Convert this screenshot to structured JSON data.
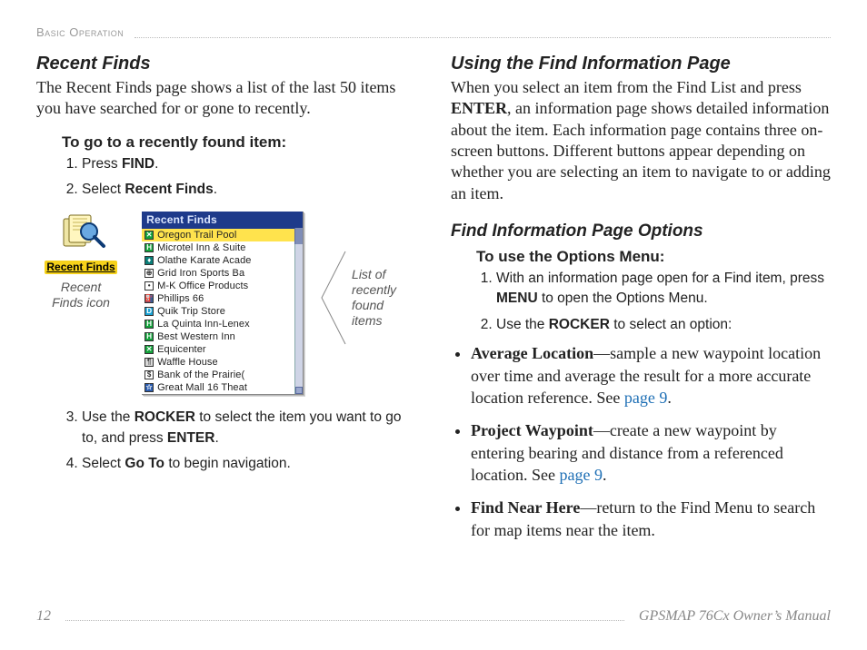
{
  "header": {
    "section": "Basic Operation"
  },
  "left": {
    "h2": "Recent Finds",
    "intro": "The Recent Finds page shows a list of the last 50 items you have searched for or gone to recently.",
    "task_title": "To go to a recently found item:",
    "steps_a": [
      {
        "pre": "Press ",
        "b": "FIND",
        "post": "."
      },
      {
        "pre": "Select ",
        "b": "Recent Finds",
        "post": "."
      }
    ],
    "icon_caption_1": "Recent",
    "icon_caption_2": "Finds icon",
    "icon_label": "Recent Finds",
    "window_title": "Recent Finds",
    "list_items": [
      {
        "glyph": "g",
        "mark": "✕",
        "text": "Oregon Trail Pool",
        "sel": true
      },
      {
        "glyph": "g",
        "mark": "H",
        "text": "Microtel Inn & Suite"
      },
      {
        "glyph": "t",
        "mark": "♦",
        "text": "Olathe Karate Acade"
      },
      {
        "glyph": "w",
        "mark": "⊕",
        "text": "Grid Iron Sports Ba"
      },
      {
        "glyph": "dot",
        "mark": "",
        "text": "M-K Office Products"
      },
      {
        "glyph": "b",
        "mark": "⛽",
        "text": "Phillips 66"
      },
      {
        "glyph": "c",
        "mark": "D",
        "text": "Quik Trip Store"
      },
      {
        "glyph": "g",
        "mark": "H",
        "text": "La Quinta Inn-Lenex"
      },
      {
        "glyph": "g",
        "mark": "H",
        "text": "Best Western Inn"
      },
      {
        "glyph": "g",
        "mark": "✕",
        "text": "Equicenter"
      },
      {
        "glyph": "r",
        "mark": "¶",
        "text": "Waffle House"
      },
      {
        "glyph": "w",
        "mark": "$",
        "text": "Bank of the Prairie("
      },
      {
        "glyph": "b",
        "mark": "☆",
        "text": "Great Mall 16 Theat"
      }
    ],
    "callout_1": "List of",
    "callout_2": "recently",
    "callout_3": "found items",
    "steps_b": [
      {
        "pre": "Use the ",
        "b": "ROCKER",
        "post": " to select the item you want to go to, and press ",
        "b2": "ENTER",
        "post2": "."
      },
      {
        "pre": "Select ",
        "b": "Go To",
        "post": " to begin navigation."
      }
    ]
  },
  "right": {
    "h2": "Using the Find Information Page",
    "p1a": "When you select an item from the Find List and press ",
    "p1b": "ENTER",
    "p1c": ", an information page shows detailed information about the item. Each information page contains three on-screen buttons. Different buttons appear depending on whether you are selecting an item to navigate to or adding an item.",
    "h3": "Find Information Page Options",
    "task_title": "To use the Options Menu:",
    "steps": [
      {
        "pre": "With an information page open for a Find item, press ",
        "b": "MENU",
        "post": " to open the Options Menu."
      },
      {
        "pre": "Use the ",
        "b": "ROCKER",
        "post": " to select an option:"
      }
    ],
    "bullets": [
      {
        "lead": "Average Location",
        "body": "—sample a new waypoint location over time and average the result for a more accurate location reference. See ",
        "link": "page 9",
        "post": "."
      },
      {
        "lead": "Project Waypoint",
        "body": "—create a new waypoint by entering bearing and distance from a referenced location. See ",
        "link": "page 9",
        "post": "."
      },
      {
        "lead": "Find Near Here",
        "body": "—return to the Find Menu to search for map items near the item."
      }
    ]
  },
  "footer": {
    "page": "12",
    "manual": "GPSMAP 76Cx Owner’s Manual"
  }
}
